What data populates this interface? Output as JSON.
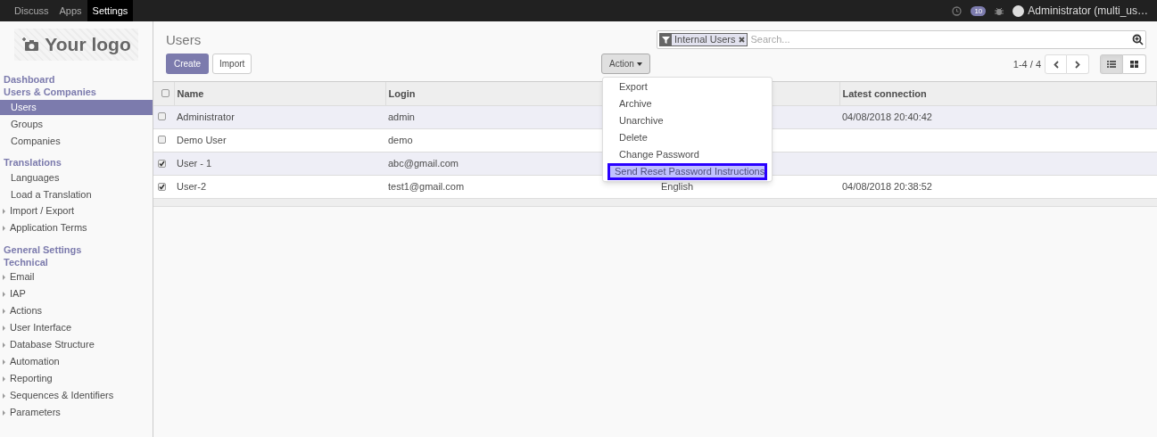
{
  "top_menu": [
    {
      "label": "Discuss",
      "selected": false
    },
    {
      "label": "Apps",
      "selected": false
    },
    {
      "label": "Settings",
      "selected": true
    }
  ],
  "systray": {
    "message_count": "10",
    "user": "Administrator (multi_us…"
  },
  "logo": {
    "text": "Your logo"
  },
  "sidebar": [
    {
      "kind": "header",
      "label": "Dashboard"
    },
    {
      "kind": "header",
      "label": "Users & Companies"
    },
    {
      "kind": "item",
      "label": "Users",
      "selected": true
    },
    {
      "kind": "item",
      "label": "Groups",
      "selected": false
    },
    {
      "kind": "item",
      "label": "Companies",
      "selected": false
    },
    {
      "kind": "header",
      "label": "Translations"
    },
    {
      "kind": "item",
      "label": "Languages",
      "selected": false
    },
    {
      "kind": "item",
      "label": "Load a Translation",
      "selected": false
    },
    {
      "kind": "folder",
      "label": "Import / Export"
    },
    {
      "kind": "folder",
      "label": "Application Terms"
    },
    {
      "kind": "header",
      "label": "General Settings"
    },
    {
      "kind": "header",
      "label": "Technical"
    },
    {
      "kind": "folder",
      "label": "Email"
    },
    {
      "kind": "folder",
      "label": "IAP"
    },
    {
      "kind": "folder",
      "label": "Actions"
    },
    {
      "kind": "folder",
      "label": "User Interface"
    },
    {
      "kind": "folder",
      "label": "Database Structure"
    },
    {
      "kind": "folder",
      "label": "Automation"
    },
    {
      "kind": "folder",
      "label": "Reporting"
    },
    {
      "kind": "folder",
      "label": "Sequences & Identifiers"
    },
    {
      "kind": "folder",
      "label": "Parameters"
    }
  ],
  "control_panel": {
    "title": "Users",
    "create": "Create",
    "import": "Import",
    "action": "Action",
    "facet": "Internal Users",
    "search_placeholder": "Search...",
    "pager": "1-4 / 4",
    "views": [
      {
        "kind": "list",
        "selected": true
      },
      {
        "kind": "kanban",
        "selected": false
      }
    ]
  },
  "table": {
    "all_checked": false,
    "columns": [
      "Name",
      "Login",
      "Latest connection"
    ],
    "rows": [
      {
        "checked": false,
        "name": "Administrator",
        "login": "admin",
        "latest": "04/08/2018 20:40:42"
      },
      {
        "checked": false,
        "name": "Demo User",
        "login": "demo"
      },
      {
        "checked": true,
        "name": "User - 1",
        "login": "abc@gmail.com"
      },
      {
        "checked": true,
        "name": "User-2",
        "login": "test1@gmail.com",
        "column_3": "English",
        "latest": "04/08/2018 20:38:52"
      }
    ]
  },
  "action_menu": [
    {
      "label": "Export",
      "selected": false
    },
    {
      "label": "Archive",
      "selected": false
    },
    {
      "label": "Unarchive",
      "selected": false
    },
    {
      "label": "Delete",
      "selected": false
    },
    {
      "label": "Change Password",
      "selected": false
    },
    {
      "label": "Send Reset Password Instructions",
      "selected": true
    }
  ]
}
